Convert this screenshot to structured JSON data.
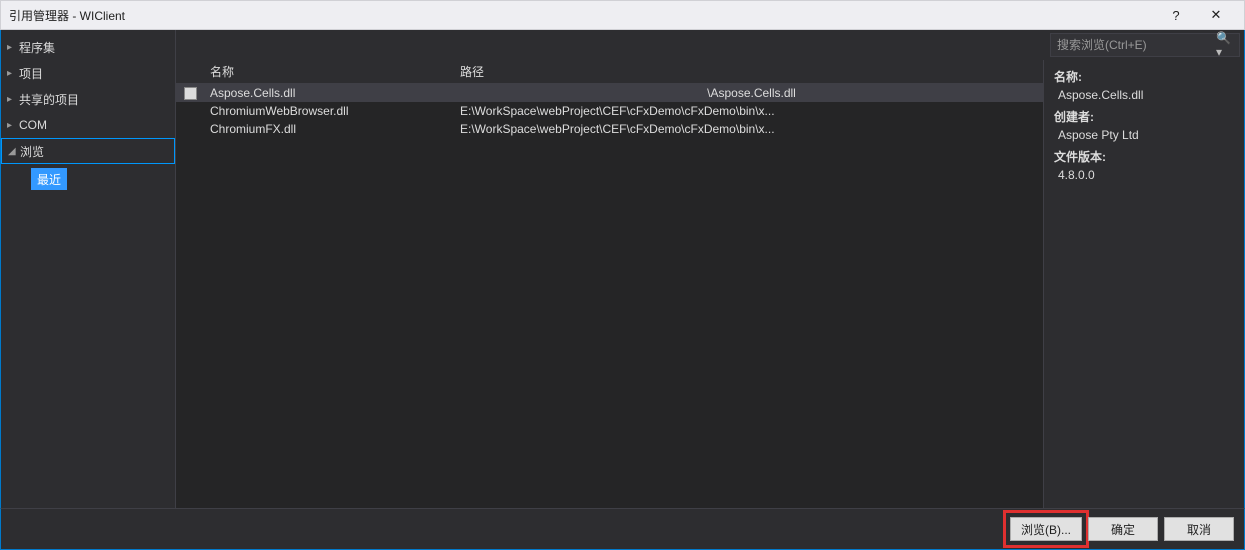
{
  "window": {
    "title": "引用管理器 - WIClient",
    "help": "?",
    "close": "✕"
  },
  "sidebar": {
    "items": [
      {
        "label": "程序集",
        "expandable": true
      },
      {
        "label": "项目",
        "expandable": true
      },
      {
        "label": "共享的项目",
        "expandable": true
      },
      {
        "label": "COM",
        "expandable": true
      },
      {
        "label": "浏览",
        "expandable": true,
        "selected": true
      }
    ],
    "subitem": "最近"
  },
  "search": {
    "placeholder": "搜索浏览(Ctrl+E)"
  },
  "table": {
    "headers": {
      "name": "名称",
      "path": "路径"
    },
    "rows": [
      {
        "name": "Aspose.Cells.dll",
        "path": "\\Aspose.Cells.dll",
        "selected": true,
        "checked": false
      },
      {
        "name": "ChromiumWebBrowser.dll",
        "path": "E:\\WorkSpace\\webProject\\CEF\\cFxDemo\\cFxDemo\\bin\\x...",
        "selected": false
      },
      {
        "name": "ChromiumFX.dll",
        "path": "E:\\WorkSpace\\webProject\\CEF\\cFxDemo\\cFxDemo\\bin\\x...",
        "selected": false
      }
    ]
  },
  "details": {
    "name_label": "名称:",
    "name_value": "Aspose.Cells.dll",
    "creator_label": "创建者:",
    "creator_value": "Aspose Pty Ltd",
    "version_label": "文件版本:",
    "version_value": "4.8.0.0"
  },
  "footer": {
    "browse": "浏览(B)...",
    "ok": "确定",
    "cancel": "取消"
  }
}
